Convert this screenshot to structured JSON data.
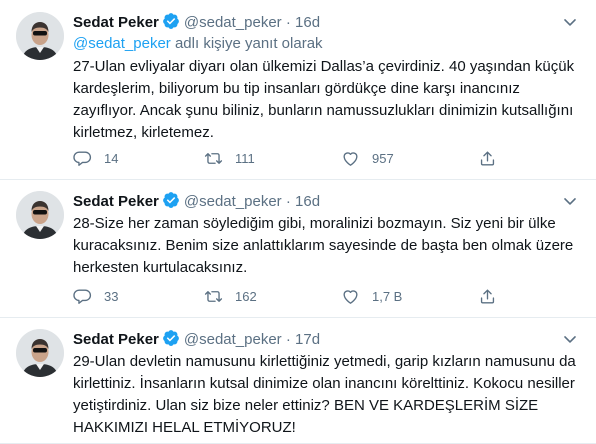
{
  "tweets": [
    {
      "name": "Sedat Peker",
      "handle": "@sedat_peker",
      "sep": "·",
      "time": "16d",
      "reply_mention": "@sedat_peker",
      "reply_suffix": " adlı kişiye yanıt olarak",
      "text": "27-Ulan evliyalar diyarı olan ülkemizi Dallas’a çevirdiniz. 40 yaşından küçük kardeşlerim, biliyorum bu tip insanları gördükçe dine karşı inancınız zayıflıyor. Ancak şunu biliniz, bunların namussuzlukları dinimizin kutsallığını kirletmez, kirletemez.",
      "replies": "14",
      "retweets": "111",
      "likes": "957"
    },
    {
      "name": "Sedat Peker",
      "handle": "@sedat_peker",
      "sep": "·",
      "time": "16d",
      "text": "28-Size her zaman söylediğim gibi, moralinizi bozmayın. Siz yeni bir ülke kuracaksınız. Benim size anlattıklarım sayesinde de başta ben olmak üzere herkesten kurtulacaksınız.",
      "replies": "33",
      "retweets": "162",
      "likes": "1,7 B"
    },
    {
      "name": "Sedat Peker",
      "handle": "@sedat_peker",
      "sep": "·",
      "time": "17d",
      "text": "29-Ulan devletin namusunu kirlettiğiniz yetmedi, garip kızların namusunu da kirlettiniz. İnsanların kutsal dinimize olan inancını körelttiniz. Kokocu nesiller yetiştirdiniz. Ulan siz bize neler ettiniz? BEN VE KARDEŞLERİM SİZE HAKKIMIZI HELAL ETMİYORUZ!"
    }
  ],
  "icons": {
    "verified": "verified-badge-icon",
    "more": "more-options-icon",
    "reply": "reply-icon",
    "retweet": "retweet-icon",
    "like": "heart-icon",
    "share": "share-icon"
  },
  "colors": {
    "accent": "#1da1f2",
    "muted": "#5b7083",
    "text": "#0f1419"
  }
}
